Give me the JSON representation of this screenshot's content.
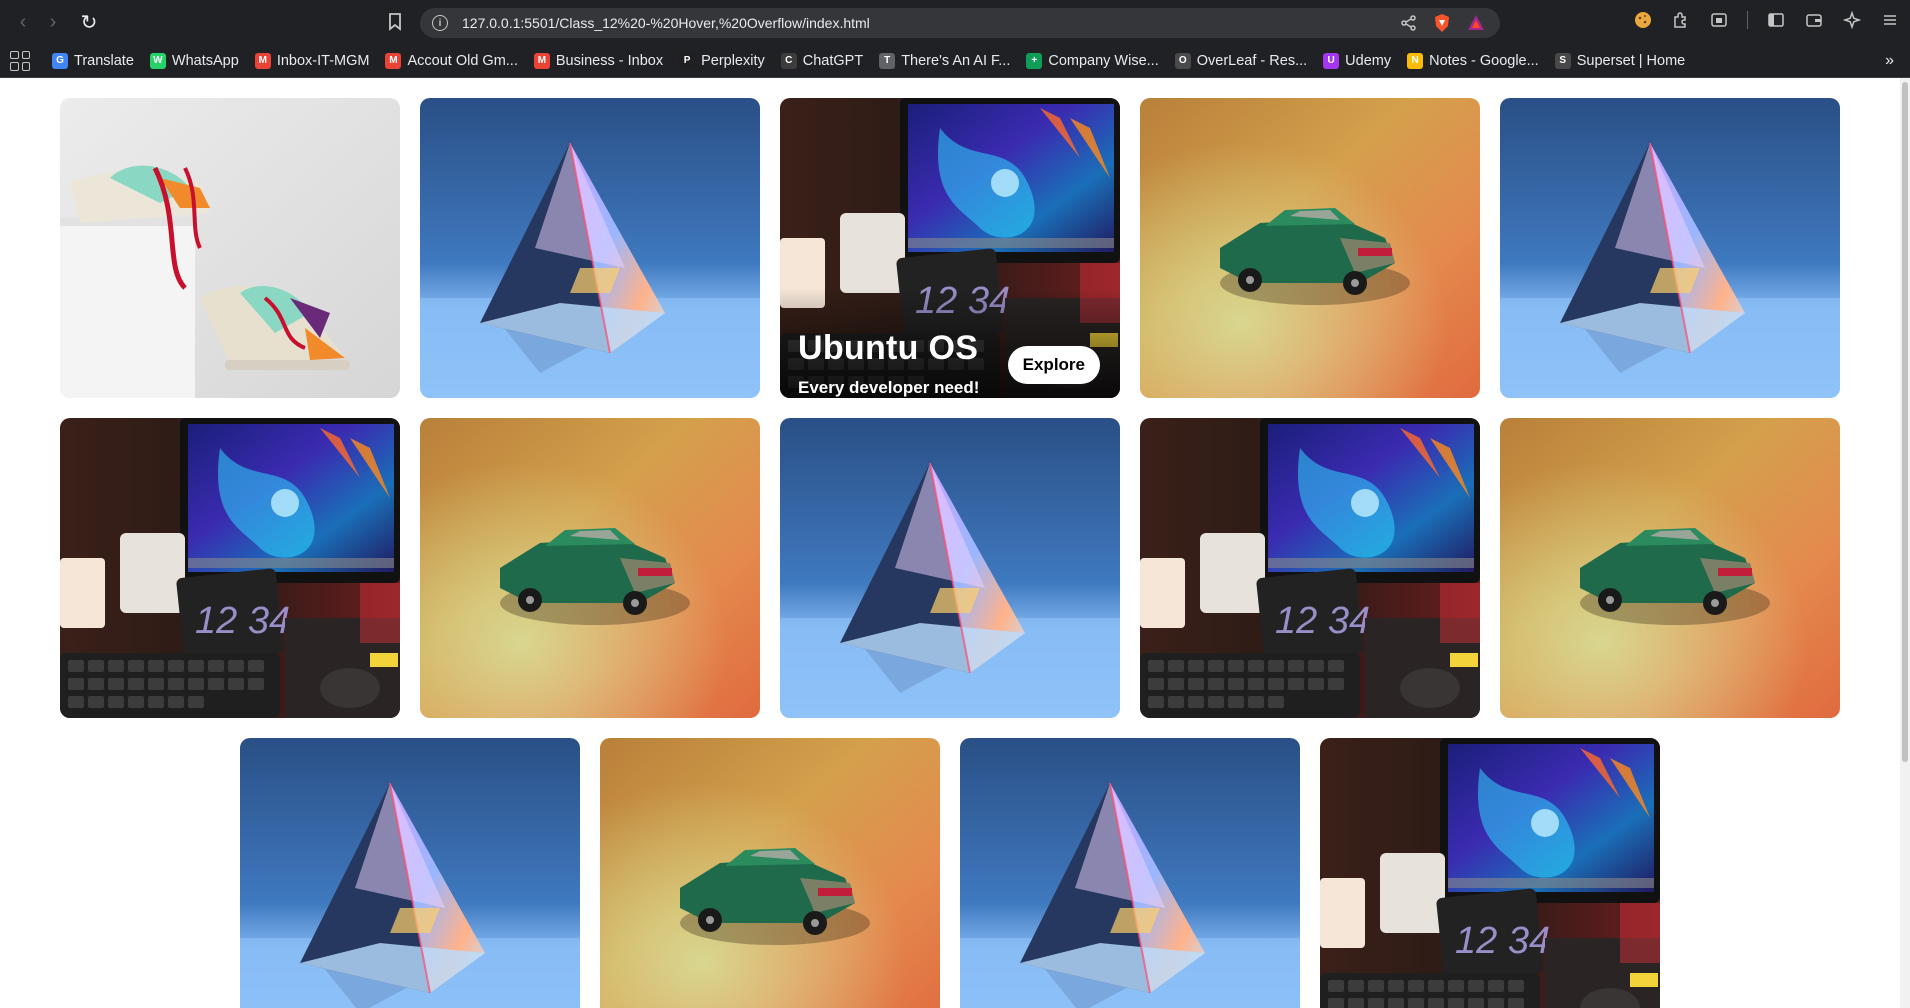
{
  "browser": {
    "url": "127.0.0.1:5501/Class_12%20-%20Hover,%20Overflow/index.html",
    "bookmarks": [
      {
        "label": "Translate",
        "color": "#4285f4",
        "glyph": "G"
      },
      {
        "label": "WhatsApp",
        "color": "#25d366",
        "glyph": "W"
      },
      {
        "label": "Inbox-IT-MGM",
        "color": "#ea4335",
        "glyph": "M"
      },
      {
        "label": "Accout Old Gm...",
        "color": "#ea4335",
        "glyph": "M"
      },
      {
        "label": "Business - Inbox",
        "color": "#ea4335",
        "glyph": "M"
      },
      {
        "label": "Perplexity",
        "color": "#1f1f1f",
        "glyph": "P"
      },
      {
        "label": "ChatGPT",
        "color": "#3c3c3c",
        "glyph": "C"
      },
      {
        "label": "There's An AI F...",
        "color": "#5f6368",
        "glyph": "T"
      },
      {
        "label": "Company Wise...",
        "color": "#0f9d58",
        "glyph": "+"
      },
      {
        "label": "OverLeaf - Res...",
        "color": "#4a4a4a",
        "glyph": "O"
      },
      {
        "label": "Udemy",
        "color": "#a435f0",
        "glyph": "U"
      },
      {
        "label": "Notes - Google...",
        "color": "#fbbc04",
        "glyph": "N"
      },
      {
        "label": "Superset | Home",
        "color": "#484848",
        "glyph": "S"
      }
    ]
  },
  "gallery": {
    "rows": [
      [
        {
          "image": "sneakers"
        },
        {
          "image": "prism"
        },
        {
          "image": "desk-setup"
        },
        {
          "image": "toy-car"
        },
        {
          "image": "prism"
        }
      ],
      [
        {
          "image": "desk-setup"
        },
        {
          "image": "toy-car"
        },
        {
          "image": "prism"
        },
        {
          "image": "desk-setup"
        },
        {
          "image": "toy-car"
        }
      ],
      [
        {
          "image": "prism"
        },
        {
          "image": "toy-car"
        },
        {
          "image": "prism"
        },
        {
          "image": "desk-setup"
        }
      ]
    ],
    "hover_card": {
      "title": "Ubuntu OS",
      "subtitle": "Every developer need!",
      "button_label": "Explore"
    }
  }
}
